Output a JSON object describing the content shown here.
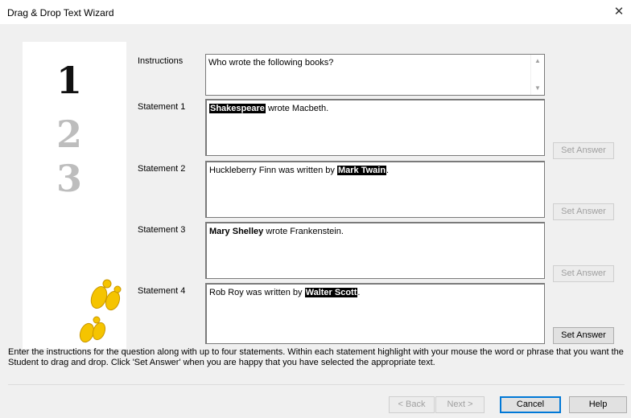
{
  "window": {
    "title": "Drag & Drop Text Wizard",
    "close_glyph": "✕"
  },
  "art": {
    "steps": [
      "1",
      "2",
      "3"
    ]
  },
  "instructions": {
    "label": "Instructions",
    "value": "Who wrote the following books?"
  },
  "statements": [
    {
      "label": "Statement 1",
      "pre": "",
      "highlight": "Shakespeare",
      "post": " wrote Macbeth.",
      "button": "Set Answer",
      "button_enabled": false
    },
    {
      "label": "Statement 2",
      "pre": "Huckleberry Finn was written by ",
      "highlight": "Mark Twain",
      "post": ".",
      "button": "Set Answer",
      "button_enabled": false
    },
    {
      "label": "Statement 3",
      "pre": "",
      "bold": "Mary Shelley",
      "post": " wrote Frankenstein.",
      "button": "Set Answer",
      "button_enabled": false
    },
    {
      "label": "Statement 4",
      "pre": "Rob Roy was written by ",
      "highlight": "Walter Scott",
      "post": ".",
      "button": "Set Answer",
      "button_enabled": true
    }
  ],
  "help_text": "Enter the instructions for the question along with up to four statements. Within each statement highlight with your mouse the word or phrase that you want the Student to drag and drop. Click 'Set Answer' when you are happy that you have selected the appropriate text.",
  "footer": {
    "back": "< Back",
    "next": "Next >",
    "cancel": "Cancel",
    "help": "Help"
  },
  "colors": {
    "highlight_bg": "#000000",
    "footprint": "#f5c400",
    "focus_border": "#0078d7"
  },
  "icons": {
    "scroll_up": "arrow-up-icon",
    "scroll_down": "arrow-down-icon",
    "close": "close-icon"
  }
}
